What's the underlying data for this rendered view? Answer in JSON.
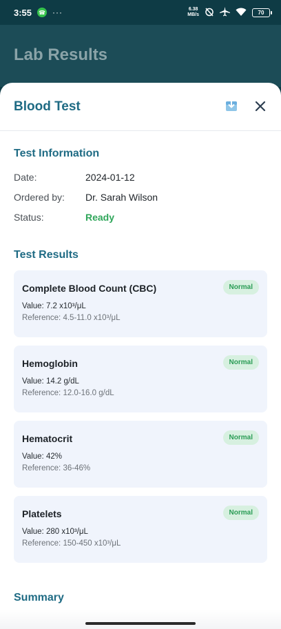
{
  "status_bar": {
    "time": "3:55",
    "more": "···",
    "net_speed_value": "6.38",
    "net_speed_unit": "MB/s",
    "battery": "70"
  },
  "app": {
    "title": "Lab Results"
  },
  "sheet": {
    "title": "Blood Test",
    "info_title": "Test Information",
    "info": [
      {
        "label": "Date:",
        "value": "2024-01-12"
      },
      {
        "label": "Ordered by:",
        "value": "Dr. Sarah Wilson"
      },
      {
        "label": "Status:",
        "value": "Ready"
      }
    ],
    "results_title": "Test Results",
    "results": [
      {
        "name": "Complete Blood Count (CBC)",
        "badge": "Normal",
        "value": "Value: 7.2 x10³/μL",
        "reference": "Reference: 4.5-11.0 x10³/μL"
      },
      {
        "name": "Hemoglobin",
        "badge": "Normal",
        "value": "Value: 14.2 g/dL",
        "reference": "Reference: 12.0-16.0 g/dL"
      },
      {
        "name": "Hematocrit",
        "badge": "Normal",
        "value": "Value: 42%",
        "reference": "Reference: 36-46%"
      },
      {
        "name": "Platelets",
        "badge": "Normal",
        "value": "Value: 280 x10³/μL",
        "reference": "Reference: 150-450 x10³/μL"
      }
    ],
    "summary_title": "Summary"
  },
  "colors": {
    "accent": "#1f6b84",
    "status_ok": "#2fa65a",
    "card_bg": "#f0f4fc",
    "badge_bg": "#d7f0e0"
  },
  "icons": {
    "download": "download-icon",
    "close": "close-icon"
  }
}
